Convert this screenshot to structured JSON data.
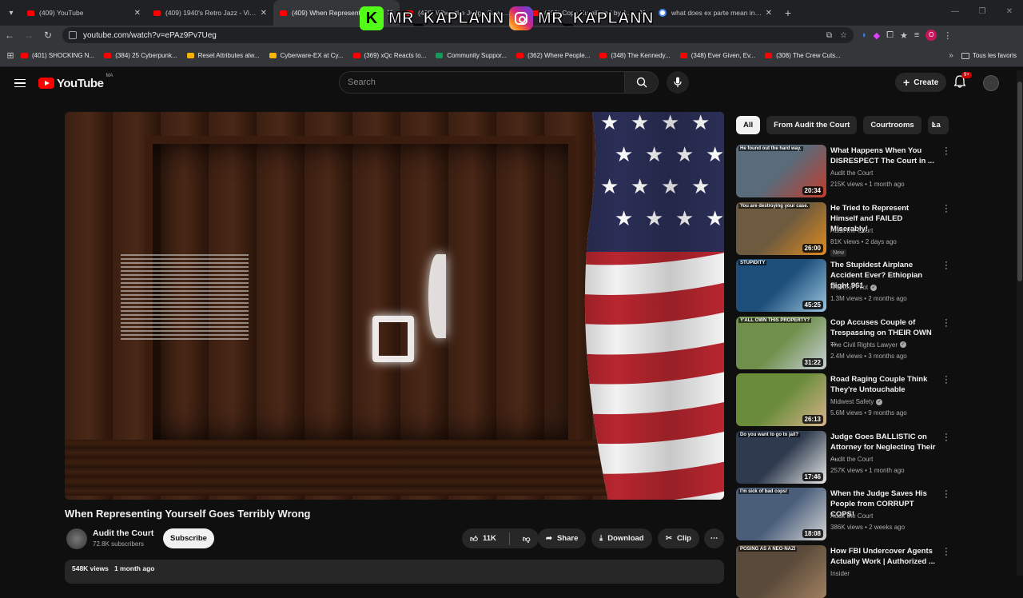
{
  "browser": {
    "tabs": [
      {
        "title": "(409) YouTube",
        "type": "yt"
      },
      {
        "title": "(409) 1940's Retro Jazz - Vintage",
        "type": "yt"
      },
      {
        "title": "(409) When Representing Yourself",
        "type": "yt",
        "active": true
      },
      {
        "title": "(409) When the Judge Saves His People",
        "type": "yt"
      },
      {
        "title": "(409) Cops Humiliated by Amy",
        "type": "yt"
      },
      {
        "title": "what does ex parte mean in law",
        "type": "google"
      }
    ],
    "url": "youtube.com/watch?v=ePAz9Pv7Ueg",
    "profile_initial": "O",
    "bookmarks": [
      {
        "label": "(401) SHOCKING N...",
        "color": "#ff0000"
      },
      {
        "label": "(384) 25 Cyberpunk...",
        "color": "#ff0000"
      },
      {
        "label": "Reset Attributes alw...",
        "color": "#f4b400"
      },
      {
        "label": "Cyberware-EX at Cy...",
        "color": "#f4b400"
      },
      {
        "label": "(369) xQc Reacts to...",
        "color": "#ff0000"
      },
      {
        "label": "Community Suppor...",
        "color": "#0f9d58"
      },
      {
        "label": "(362) Where People...",
        "color": "#ff0000"
      },
      {
        "label": "(348) The Kennedy...",
        "color": "#ff0000"
      },
      {
        "label": "(348) Ever Given, Ev...",
        "color": "#ff0000"
      },
      {
        "label": "(308) The Crew Cuts...",
        "color": "#ff0000"
      }
    ],
    "all_bookmarks_label": "Tous les favoris"
  },
  "watermark": {
    "text1": "MR_KAPLANN",
    "text2": "MR_KAPLANN",
    "k_letter": "K"
  },
  "youtube": {
    "logo_text": "YouTube",
    "region": "MA",
    "search_placeholder": "Search",
    "create_label": "Create",
    "notif_count": "9+",
    "video": {
      "title": "When Representing Yourself Goes Terribly Wrong",
      "channel": "Audit the Court",
      "subscribers": "72.8K subscribers",
      "subscribe_label": "Subscribe",
      "likes": "11K",
      "share_label": "Share",
      "download_label": "Download",
      "clip_label": "Clip",
      "views": "548K views",
      "age": "1 month ago"
    },
    "chips": [
      "All",
      "From Audit the Court",
      "Courtrooms",
      "La"
    ],
    "recommendations": [
      {
        "title": "What Happens When You DISRESPECT The Court in ...",
        "channel": "Audit the Court",
        "verified": false,
        "meta": "215K views • 1 month ago",
        "duration": "20:34",
        "caption": "He found out the hard way.",
        "colors": [
          "#5a6b7a",
          "#c43b2b"
        ]
      },
      {
        "title": "He Tried to Represent Himself and FAILED Miserably!",
        "channel": "Audit the Court",
        "verified": false,
        "meta": "81K views • 2 days ago",
        "badge": "New",
        "duration": "26:00",
        "caption": "You are destroying your case.",
        "colors": [
          "#6d5a3f",
          "#e08b1f"
        ]
      },
      {
        "title": "The Stupidest Airplane Accident Ever? Ethiopian flight 961",
        "channel": "Mentour Pilot",
        "verified": true,
        "meta": "1.3M views • 2 months ago",
        "duration": "45:25",
        "caption": "STUPIDITY",
        "colors": [
          "#1d4f7a",
          "#9cc6e0"
        ]
      },
      {
        "title": "Cop Accuses Couple of Trespassing on THEIR OWN ...",
        "channel": "The Civil Rights Lawyer",
        "verified": true,
        "meta": "2.4M views • 3 months ago",
        "duration": "31:22",
        "caption": "Y'ALL OWN THIS PROPERTY?",
        "colors": [
          "#6f8f4a",
          "#c9d1d9"
        ]
      },
      {
        "title": "Road Raging Couple Think They're Untouchable",
        "channel": "Midwest Safety",
        "verified": true,
        "meta": "5.6M views • 9 months ago",
        "duration": "26:13",
        "caption": "",
        "colors": [
          "#6a8c3a",
          "#d9b38c"
        ]
      },
      {
        "title": "Judge Goes BALLISTIC on Attorney for Neglecting Their ...",
        "channel": "Audit the Court",
        "verified": false,
        "meta": "257K views • 1 month ago",
        "duration": "17:46",
        "caption": "Do you want to go to jail?",
        "colors": [
          "#2e3b4e",
          "#e9e9e9"
        ]
      },
      {
        "title": "When the Judge Saves His People from CORRUPT COPS!",
        "channel": "Audit the Court",
        "verified": false,
        "meta": "386K views • 2 weeks ago",
        "duration": "18:08",
        "caption": "I'm sick of bad cops!",
        "colors": [
          "#4a5e7a",
          "#d7d7d7"
        ]
      },
      {
        "title": "How FBI Undercover Agents Actually Work | Authorized ...",
        "channel": "Insider",
        "verified": false,
        "meta": "",
        "duration": "",
        "caption": "POSING AS A NEO-NAZI",
        "colors": [
          "#5a4a3a",
          "#a08060"
        ]
      }
    ]
  }
}
